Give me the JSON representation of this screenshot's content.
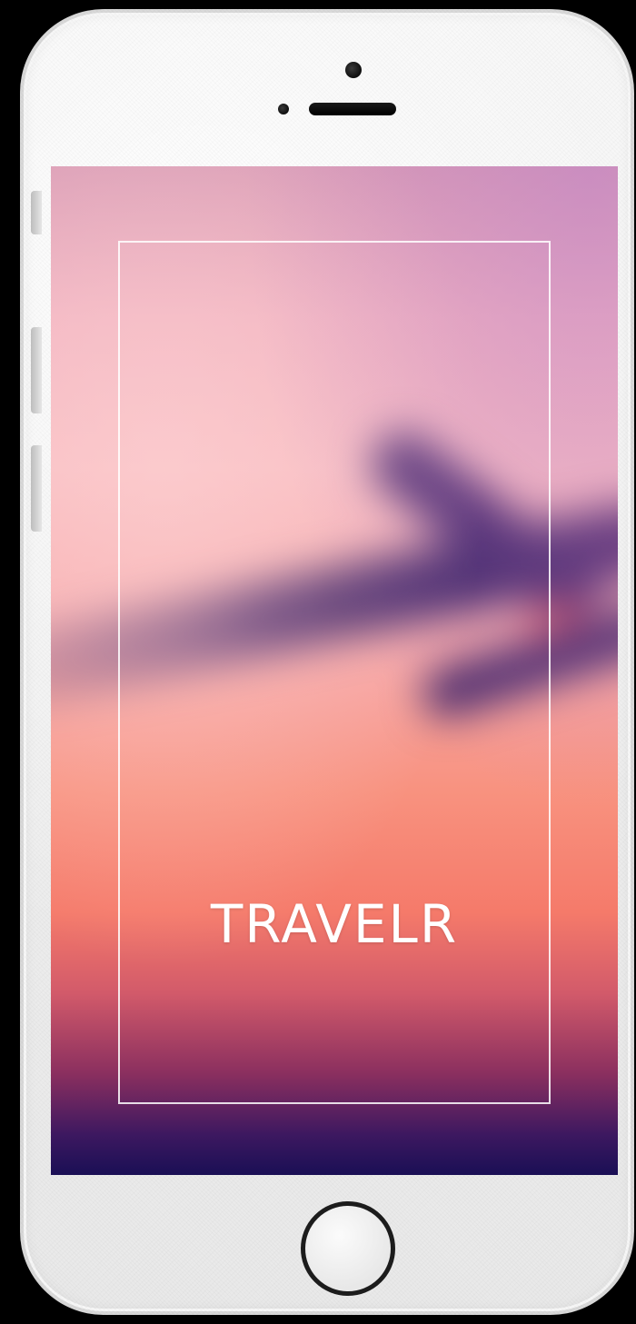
{
  "app": {
    "title": "TRAVELR"
  },
  "colors": {
    "screen_top": "#d99bb5",
    "screen_mid": "#f8927f",
    "screen_bottom": "#1a0f55",
    "plane": "#4a2a6e",
    "title_text": "#ffffff",
    "phone_body": "#f0f0f0"
  },
  "icons": {
    "camera": "front-camera-icon",
    "speaker": "earpiece-speaker-icon",
    "home": "home-button-icon"
  }
}
